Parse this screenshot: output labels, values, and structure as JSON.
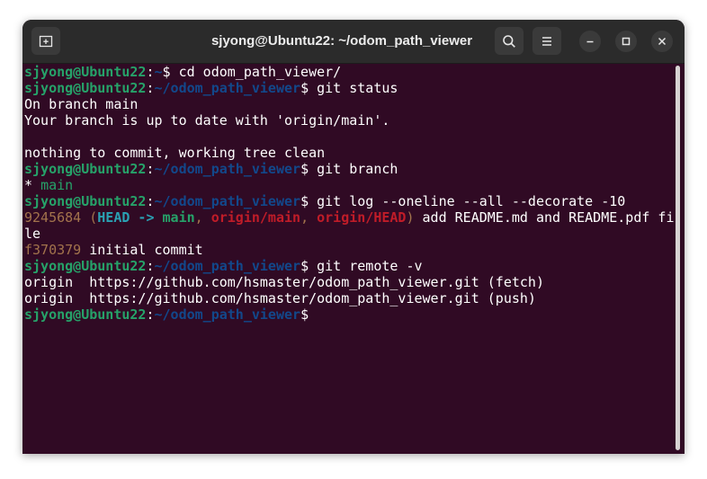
{
  "window": {
    "title": "sjyong@Ubuntu22: ~/odom_path_viewer"
  },
  "titlebar": {
    "icons": {
      "new_tab": "new-tab-icon",
      "search": "search-icon",
      "menu": "hamburger-menu-icon",
      "minimize": "minimize-icon",
      "maximize": "maximize-icon",
      "close": "close-icon"
    }
  },
  "colors": {
    "terminal_bg": "#300a24",
    "titlebar_bg": "#2b2b2b",
    "prompt_user": "#26a269",
    "prompt_path": "#12488b",
    "hash": "#a2734c",
    "head": "#2aa1b3",
    "remote_ref": "#c01c28"
  },
  "terminal": {
    "prompt_user": "sjyong@Ubuntu22",
    "prompt_colon": ":",
    "home_path": "~",
    "repo_path": "~/odom_path_viewer",
    "prompt_dollar": "$",
    "cmd_cd": " cd odom_path_viewer/",
    "cmd_status": " git status",
    "status_line1": "On branch main",
    "status_line2": "Your branch is up to date with 'origin/main'.",
    "status_line3": "nothing to commit, working tree clean",
    "cmd_branch": " git branch",
    "branch_star": "* ",
    "branch_name": "main",
    "cmd_log": " git log --oneline --all --decorate -10",
    "log1_hash": "9245684",
    "log1_open": " (",
    "log1_head": "HEAD -> ",
    "log1_main": "main",
    "log1_sep1": ", ",
    "log1_origin_main": "origin/main",
    "log1_sep2": ", ",
    "log1_origin_head": "origin/HEAD",
    "log1_close": ")",
    "log1_msg": " add README.md and README.pdf fi",
    "log1_wrap": "le",
    "log2_hash": "f370379",
    "log2_msg": " initial commit",
    "cmd_remote": " git remote -v",
    "remote_fetch": "origin  https://github.com/hsmaster/odom_path_viewer.git (fetch)",
    "remote_push": "origin  https://github.com/hsmaster/odom_path_viewer.git (push)"
  }
}
